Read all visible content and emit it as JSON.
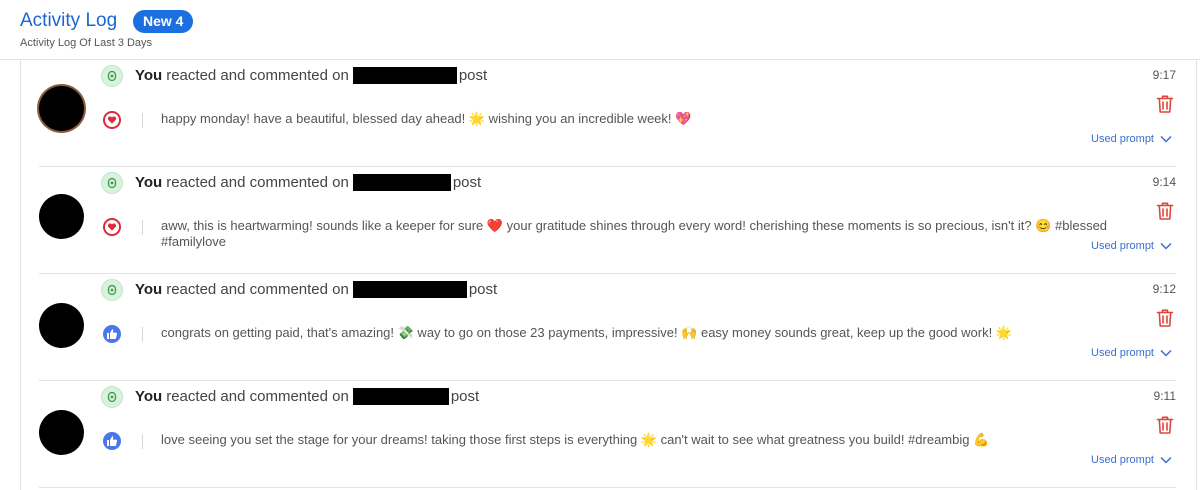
{
  "header": {
    "title": "Activity Log",
    "badge": "New 4",
    "subtitle": "Activity Log Of Last 3 Days"
  },
  "colors": {
    "accent": "#1a66d2",
    "badge": "#1b6fe0",
    "delete": "#e0453a",
    "heart": "#d92b3a",
    "like": "#4a77e8",
    "status": "#d9f2dc"
  },
  "items": [
    {
      "you": "You",
      "action": "reacted and commented on",
      "suffix": "post",
      "time": "9:17",
      "reaction": "heart-icon",
      "comment": "happy monday! have a beautiful, blessed day ahead! 🌟 wishing you an incredible week! 💖",
      "prompt_label": "Used prompt"
    },
    {
      "you": "You",
      "action": "reacted and commented on",
      "suffix": "post",
      "time": "9:14",
      "reaction": "heart-icon",
      "comment": "aww, this is heartwarming! sounds like a keeper for sure ❤️ your gratitude shines through every word! cherishing these moments is so precious, isn't it? 😊 #blessed #familylove",
      "prompt_label": "Used prompt"
    },
    {
      "you": "You",
      "action": "reacted and commented on",
      "suffix": "post",
      "time": "9:12",
      "reaction": "like-icon",
      "comment": "congrats on getting paid, that's amazing! 💸 way to go on those 23 payments, impressive! 🙌 easy money sounds great, keep up the good work! 🌟",
      "prompt_label": "Used prompt"
    },
    {
      "you": "You",
      "action": "reacted and commented on",
      "suffix": "post",
      "time": "9:11",
      "reaction": "like-icon",
      "comment": "love seeing you set the stage for your dreams! taking those first steps is everything 🌟 can't wait to see what greatness you build! #dreambig 💪",
      "prompt_label": "Used prompt"
    }
  ]
}
